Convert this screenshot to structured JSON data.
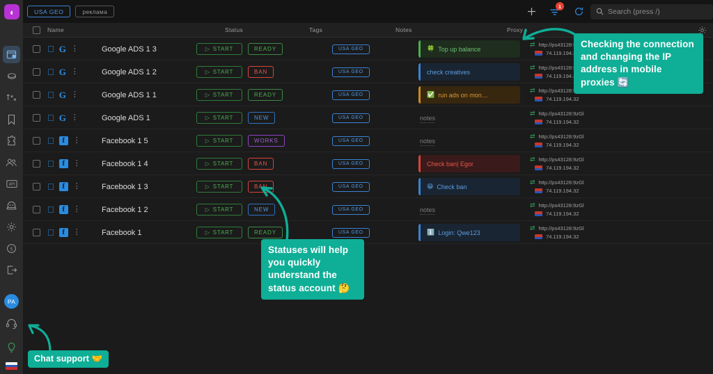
{
  "app": {
    "logo_glyph": "◖",
    "accent": "#0fae96",
    "blue": "#2a8ce0",
    "green": "#4caf50",
    "red": "#e8564a",
    "purple": "#a45fd6"
  },
  "sidebar": {
    "items": [
      {
        "name": "browser-profiles",
        "label": "Browser profiles",
        "active": true
      },
      {
        "name": "cookies",
        "label": "Cookies",
        "active": false
      },
      {
        "name": "accounts-transfer",
        "label": "Accounts transfer",
        "active": false
      },
      {
        "name": "bookmarks",
        "label": "Bookmarks",
        "active": false
      },
      {
        "name": "extensions",
        "label": "Extensions",
        "active": false
      },
      {
        "name": "team",
        "label": "Team",
        "active": false
      },
      {
        "name": "api",
        "label": "API",
        "active": false
      },
      {
        "name": "automation",
        "label": "Automation",
        "active": false
      },
      {
        "name": "settings",
        "label": "Settings",
        "active": false
      },
      {
        "name": "billing",
        "label": "Billing",
        "active": false
      },
      {
        "name": "logout",
        "label": "Logout",
        "active": false
      }
    ],
    "avatar_initials": "PA",
    "support_icon": "headset-icon",
    "tips_icon": "lightbulb-icon",
    "language_flag": "ru-flag-icon"
  },
  "topbar": {
    "chips": [
      {
        "label": "USA GEO",
        "style": "blue"
      },
      {
        "label": "реклама",
        "style": "gray"
      }
    ],
    "add_label": "+",
    "filter_badge": "1",
    "icons": [
      "plus-icon",
      "filter-icon",
      "refresh-icon"
    ],
    "search": {
      "placeholder": "Search (press /)",
      "value": ""
    }
  },
  "table": {
    "columns": [
      "Name",
      "Status",
      "Tags",
      "Notes",
      "Proxy"
    ],
    "settings_icon": "gear-icon",
    "start_label": "START",
    "rows": [
      {
        "name": "Google ADS 1 3",
        "platform": "google",
        "status": "READY",
        "tag": "USA GEO",
        "note": {
          "text": "Top up balance",
          "emoji": "🍀",
          "color": "green"
        },
        "proxy_url": "http://ps43128:9zGl",
        "proxy_ip": "74.119.194.32"
      },
      {
        "name": "Google ADS 1 2",
        "platform": "google",
        "status": "BAN",
        "tag": "USA GEO",
        "note": {
          "text": "check creatives",
          "emoji": "",
          "color": "blue"
        },
        "proxy_url": "http://ps43128:9zGl",
        "proxy_ip": "74.119.194.32"
      },
      {
        "name": "Google ADS 1 1",
        "platform": "google",
        "status": "READY",
        "tag": "USA GEO",
        "note": {
          "text": "run ads on mon…",
          "emoji": "✅",
          "color": "orange"
        },
        "proxy_url": "http://ps43128:9zGl",
        "proxy_ip": "74.119.194.32"
      },
      {
        "name": "Google ADS 1",
        "platform": "google",
        "status": "NEW",
        "tag": "USA GEO",
        "note": {
          "text": "notes",
          "emoji": "",
          "color": "empty"
        },
        "proxy_url": "http://ps43128:9zGl",
        "proxy_ip": "74.119.194.32"
      },
      {
        "name": "Facebook 1 5",
        "platform": "facebook",
        "status": "WORKS",
        "tag": "USA GEO",
        "note": {
          "text": "notes",
          "emoji": "",
          "color": "empty"
        },
        "proxy_url": "http://ps43128:9zGl",
        "proxy_ip": "74.119.194.32"
      },
      {
        "name": "Facebook 1 4",
        "platform": "facebook",
        "status": "BAN",
        "tag": "USA GEO",
        "note": {
          "text": "Check ban| Egor",
          "emoji": "",
          "color": "red"
        },
        "proxy_url": "http://ps43128:9zGl",
        "proxy_ip": "74.119.194.32"
      },
      {
        "name": "Facebook 1 3",
        "platform": "facebook",
        "status": "BAN",
        "tag": "USA GEO",
        "note": {
          "text": "Check ban",
          "emoji": "😁",
          "color": "blue"
        },
        "proxy_url": "http://ps43128:9zGl",
        "proxy_ip": "74.119.194.32"
      },
      {
        "name": "Facebook 1 2",
        "platform": "facebook",
        "status": "NEW",
        "tag": "USA GEO",
        "note": {
          "text": "notes",
          "emoji": "",
          "color": "empty"
        },
        "proxy_url": "http://ps43128:9zGl",
        "proxy_ip": "74.119.194.32"
      },
      {
        "name": "Facebook 1",
        "platform": "facebook",
        "status": "READY",
        "tag": "USA GEO",
        "note": {
          "text": "Login: Qwe123",
          "emoji": "ℹ️",
          "color": "blue"
        },
        "proxy_url": "http://ps43128:9zGl",
        "proxy_ip": "74.119.194.32"
      }
    ]
  },
  "callouts": {
    "proxy": "Checking the connection and changing the IP address in mobile proxies 🔄",
    "status": "Statuses will help you quickly understand the status account 🤔",
    "chat": "Chat support 🤝"
  }
}
